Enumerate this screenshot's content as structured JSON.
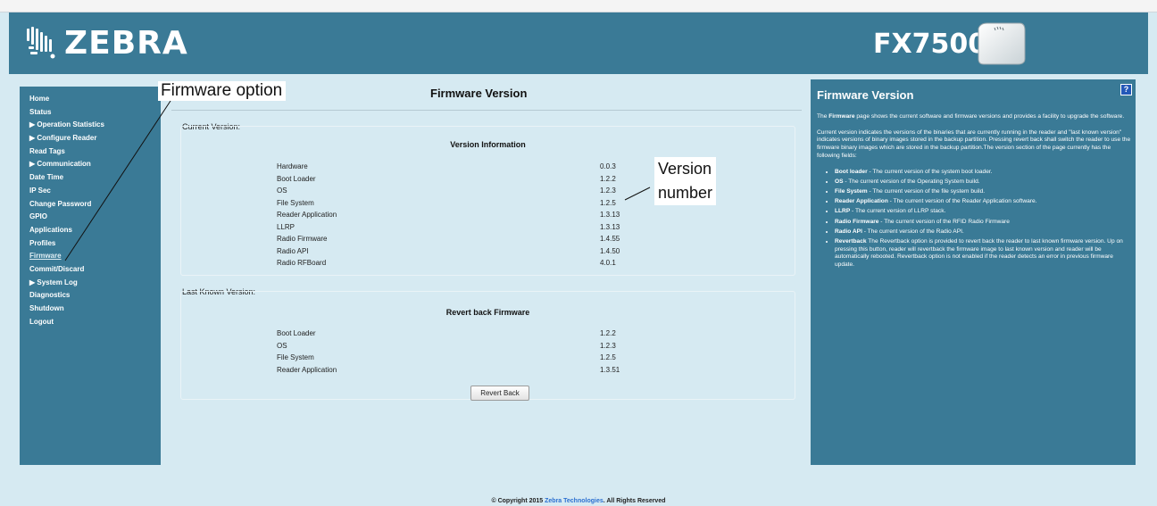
{
  "header": {
    "brand": "ZEBRA",
    "model": "FX7500"
  },
  "sidebar": {
    "items": [
      {
        "label": "Home"
      },
      {
        "label": "Status"
      },
      {
        "label": "▶ Operation Statistics"
      },
      {
        "label": "▶ Configure Reader"
      },
      {
        "label": "Read Tags"
      },
      {
        "label": "▶ Communication"
      },
      {
        "label": "Date Time"
      },
      {
        "label": "IP Sec"
      },
      {
        "label": "Change Password"
      },
      {
        "label": "GPIO"
      },
      {
        "label": "Applications"
      },
      {
        "label": "Profiles"
      },
      {
        "label": "Firmware",
        "active": true
      },
      {
        "label": "Commit/Discard"
      },
      {
        "label": "▶ System Log"
      },
      {
        "label": "Diagnostics"
      },
      {
        "label": "Shutdown"
      },
      {
        "label": "Logout"
      }
    ]
  },
  "main": {
    "title": "Firmware Version",
    "current": {
      "label": "Current Version:",
      "heading": "Version Information",
      "rows": [
        {
          "name": "Hardware",
          "value": "0.0.3"
        },
        {
          "name": "Boot Loader",
          "value": "1.2.2"
        },
        {
          "name": "OS",
          "value": "1.2.3"
        },
        {
          "name": "File System",
          "value": "1.2.5"
        },
        {
          "name": "Reader Application",
          "value": "1.3.13"
        },
        {
          "name": "LLRP",
          "value": "1.3.13"
        },
        {
          "name": "Radio Firmware",
          "value": "1.4.55"
        },
        {
          "name": "Radio API",
          "value": "1.4.50"
        },
        {
          "name": "Radio RFBoard",
          "value": "4.0.1"
        }
      ]
    },
    "last_known": {
      "label": "Last Known Version:",
      "heading": "Revert back Firmware",
      "rows": [
        {
          "name": "Boot Loader",
          "value": "1.2.2"
        },
        {
          "name": "OS",
          "value": "1.2.3"
        },
        {
          "name": "File System",
          "value": "1.2.5"
        },
        {
          "name": "Reader Application",
          "value": "1.3.51"
        }
      ],
      "button": "Revert Back"
    }
  },
  "help": {
    "title": "Firmware Version",
    "icon": "?",
    "intro_lead": "The ",
    "intro_bold": "Firmware",
    "intro_rest": " page shows the current software and firmware versions and provides a facility to upgrade the software.",
    "body": "Current version indicates the versions of the binaries that are currently running in the reader and \"last known version\" indicates versions of binary images stored in the backup partition. Pressing revert back shall switch the reader to use the firmware binary images which are stored in the backup partition.The version section of the page currently has the following fields:",
    "items": [
      {
        "term": "Boot loader",
        "desc": " - The current version of the system boot loader."
      },
      {
        "term": "OS",
        "desc": " - The current version of the Operating System build."
      },
      {
        "term": "File System",
        "desc": " - The current version of the file system build."
      },
      {
        "term": "Reader Application",
        "desc": " - The current version of the Reader Application software."
      },
      {
        "term": "LLRP",
        "desc": " - The current version of LLRP stack."
      },
      {
        "term": "Radio Firmware",
        "desc": " - The current version of the RFID Radio Firmware"
      },
      {
        "term": "Radio API",
        "desc": " - The current version of the Radio API."
      },
      {
        "term": "Revertback",
        "desc": " The Revertback option is provided to revert back the reader to last known firmware version. Up on pressing this button, reader will revertback the firmware image to last known version and reader will be automatically rebooted. Revertback option is not enabled if the reader detects an error in previous firmware update."
      }
    ]
  },
  "footer": {
    "prefix": "© Copyright 2015 ",
    "link": "Zebra Technologies",
    "suffix": ". All Rights Reserved"
  },
  "annotations": {
    "firmware_option": "Firmware option",
    "version_line1": "Version",
    "version_line2": "number"
  },
  "colors": {
    "brand_panel": "#3a7a96",
    "page_background": "#d6eaf2",
    "link": "#2a6fd0"
  }
}
